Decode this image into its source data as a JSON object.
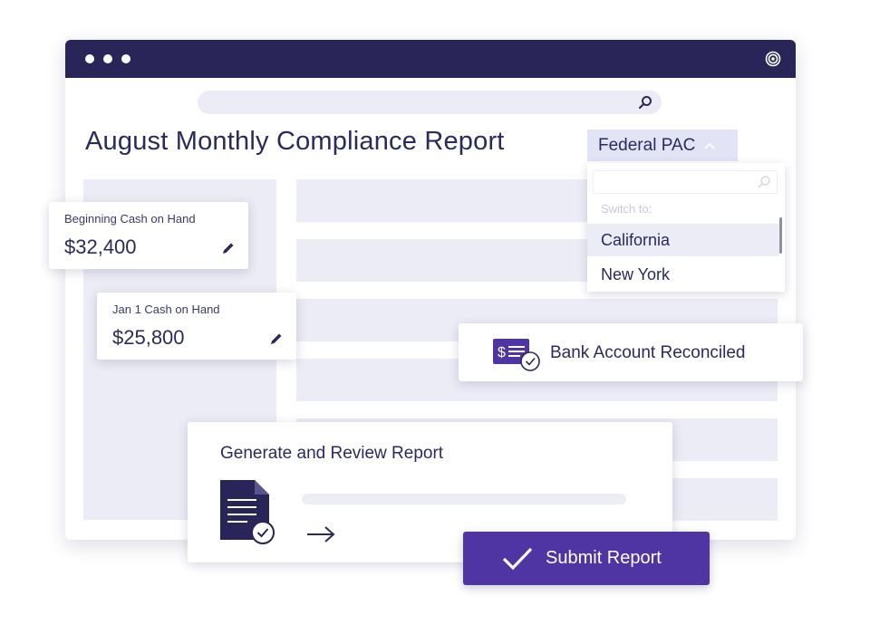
{
  "window": {
    "brand_icon": "swirl-logo-icon",
    "titlebar_color": "#2a2559",
    "search": {
      "icon": "search-icon"
    }
  },
  "header": {
    "title": "August Monthly Compliance Report",
    "account_selector": {
      "label": "Federal PAC",
      "icon": "chevron-up-icon"
    }
  },
  "dropdown": {
    "hint": "Switch to:",
    "search_icon": "search-icon",
    "options": [
      {
        "label": "California",
        "active": true
      },
      {
        "label": "New York",
        "active": false
      }
    ]
  },
  "cards": {
    "beginning_cash": {
      "label": "Beginning Cash on Hand",
      "value": "$32,400",
      "icon": "pencil-icon"
    },
    "jan1_cash": {
      "label": "Jan 1 Cash on Hand",
      "value": "$25,800",
      "icon": "pencil-icon"
    },
    "bank": {
      "label": "Bank Account Reconciled",
      "icon": "bank-check-icon"
    },
    "generate": {
      "title": "Generate and Review Report",
      "doc_icon": "document-check-icon",
      "arrow_icon": "arrow-right-icon"
    }
  },
  "actions": {
    "submit_label": "Submit Report",
    "submit_icon": "checkmark-icon"
  },
  "colors": {
    "primary": "#4f34a4",
    "navy": "#2a2559",
    "placeholder": "#ececf6"
  }
}
